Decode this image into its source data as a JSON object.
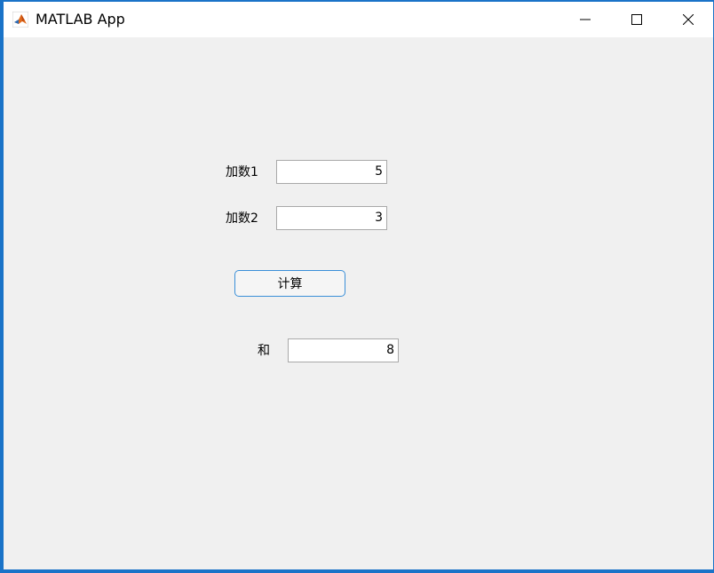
{
  "window": {
    "title": "MATLAB App",
    "icon": "matlab-logo-icon",
    "controls": [
      "minimize-icon",
      "maximize-icon",
      "close-icon"
    ]
  },
  "form": {
    "addend1_label": "加数1",
    "addend1_value": "5",
    "addend2_label": "加数2",
    "addend2_value": "3",
    "calc_button_label": "计算",
    "sum_label": "和",
    "sum_value": "8"
  },
  "colors": {
    "window_border": "#1a73c8",
    "background": "#f0f0f0",
    "button_border": "#3a8fd8"
  }
}
